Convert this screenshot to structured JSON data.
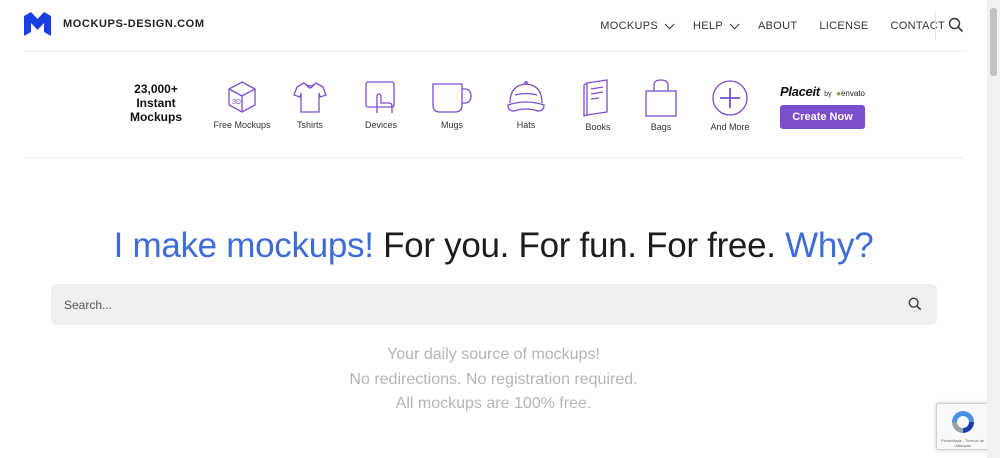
{
  "brand": {
    "name": "MOCKUPS-DESIGN.COM",
    "logo_color": "#1b3ee0"
  },
  "nav": {
    "items": [
      {
        "label": "MOCKUPS",
        "has_dropdown": true
      },
      {
        "label": "HELP",
        "has_dropdown": true
      },
      {
        "label": "ABOUT",
        "has_dropdown": false
      },
      {
        "label": "LICENSE",
        "has_dropdown": false
      },
      {
        "label": "CONTACT",
        "has_dropdown": false
      }
    ],
    "search_icon": "search-icon"
  },
  "categories": {
    "count_text": [
      "23,000+",
      "Instant",
      "Mockups"
    ],
    "icon_color": "#7c4dcc",
    "items": [
      {
        "label": "Free Mockups",
        "icon": "box-3d-icon"
      },
      {
        "label": "Tshirts",
        "icon": "tshirt-icon"
      },
      {
        "label": "Devices",
        "icon": "tablet-hand-icon"
      },
      {
        "label": "Mugs",
        "icon": "mug-icon"
      },
      {
        "label": "Hats",
        "icon": "cap-icon"
      },
      {
        "label": "Books",
        "icon": "book-icon"
      },
      {
        "label": "Bags",
        "icon": "bag-icon"
      },
      {
        "label": "And More",
        "icon": "plus-circle-icon"
      }
    ],
    "promo": {
      "logo": "Placeit",
      "by": "by",
      "partner": "envato",
      "button": "Create Now",
      "button_color": "#7c4dcc"
    }
  },
  "hero": {
    "part1": "I make mockups!",
    "part2": "For you. For fun. For free.",
    "part3": "Why?",
    "accent_color": "#3f6cd9"
  },
  "search": {
    "placeholder": "Search..."
  },
  "taglines": [
    "Your daily source of mockups!",
    "No redirections. No registration required.",
    "All mockups are 100% free."
  ],
  "recaptcha": {
    "text": "Privacidade - Termos de Utilização"
  }
}
